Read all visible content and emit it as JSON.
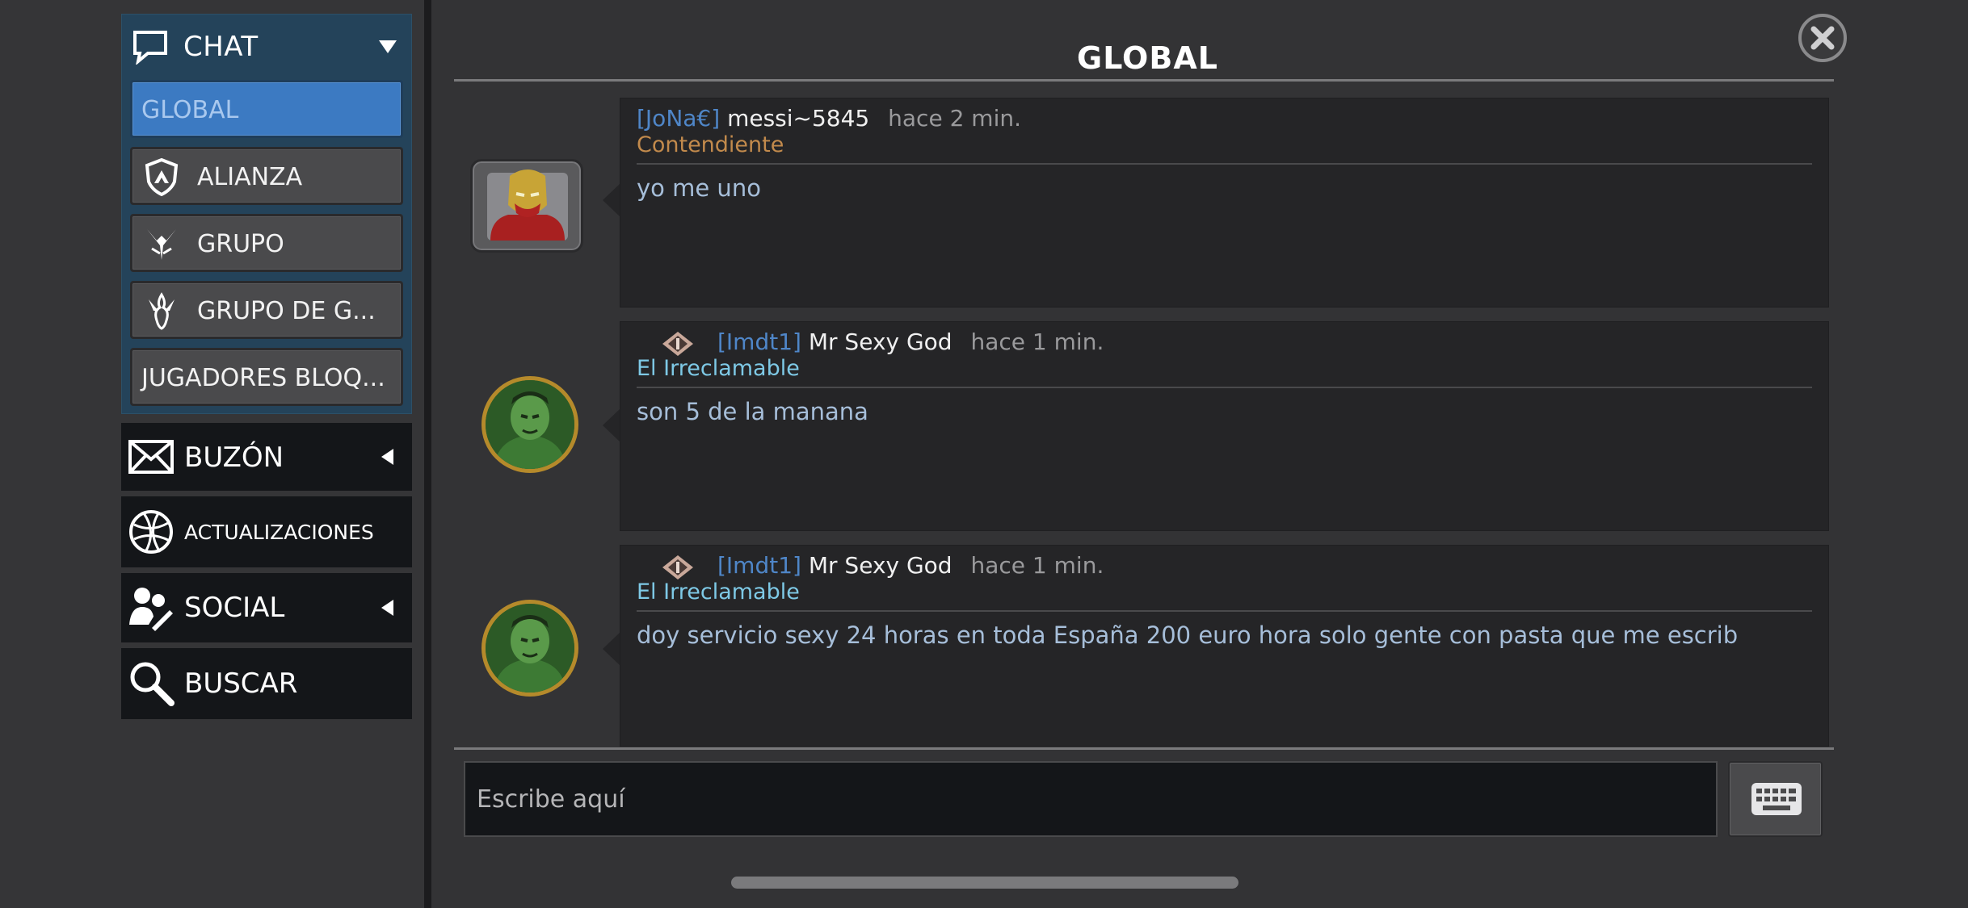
{
  "sidebar": {
    "chat": {
      "label": "CHAT",
      "items": [
        {
          "label": "GLOBAL",
          "icon": "none"
        },
        {
          "label": "ALIANZA",
          "icon": "alliance-shield-icon"
        },
        {
          "label": "GRUPO",
          "icon": "group-wings-icon"
        },
        {
          "label": "GRUPO DE G...",
          "icon": "war-group-icon"
        },
        {
          "label": "JUGADORES BLOQ...",
          "icon": "none"
        }
      ]
    },
    "mailbox": {
      "label": "BUZÓN"
    },
    "updates": {
      "label": "ACTUALIZACIONES"
    },
    "social": {
      "label": "SOCIAL"
    },
    "search": {
      "label": "BUSCAR"
    }
  },
  "main": {
    "title": "GLOBAL",
    "messages": [
      {
        "tag": "[JoNa€]",
        "user": "messi~5845",
        "time": "hace 2 min.",
        "rank": "Contendiente",
        "rank_color": "#c28a4c",
        "text": "yo me uno",
        "avatar": "iron-man-avatar"
      },
      {
        "tag": "[Imdt1]",
        "user": "Mr Sexy God",
        "time": "hace 1 min.",
        "rank": "El Irreclamable",
        "rank_color": "#7ec9e6",
        "text": "son 5 de la manana",
        "avatar": "hulk-avatar"
      },
      {
        "tag": "[Imdt1]",
        "user": "Mr Sexy God",
        "time": "hace 1 min.",
        "rank": "El Irreclamable",
        "rank_color": "#7ec9e6",
        "text": "doy servicio sexy 24 horas en toda España 200 euro hora solo gente con pasta que me escrib",
        "avatar": "hulk-avatar"
      }
    ],
    "input": {
      "placeholder": "Escribe aquí"
    }
  },
  "colors": {
    "accent": "#3c7ac2",
    "tag": "#4f86c8",
    "message_text": "#a6bed9"
  }
}
